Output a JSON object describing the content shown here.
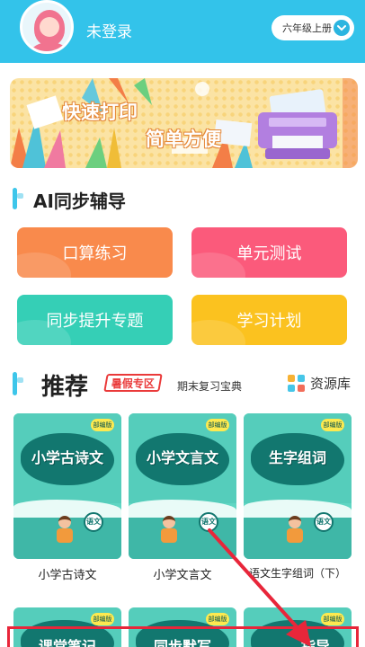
{
  "header": {
    "login_status": "未登录",
    "grade_selector": "六年级上册"
  },
  "banner": {
    "title_line1": "快速打印",
    "title_line2": "简单方便"
  },
  "ai_section": {
    "title": "AI同步辅导",
    "buttons": [
      {
        "label": "口算练习",
        "color": "#f98a4c"
      },
      {
        "label": "单元测试",
        "color": "#fb5a7b"
      },
      {
        "label": "同步提升专题",
        "color": "#35cfb6"
      },
      {
        "label": "学习计划",
        "color": "#fbc21f"
      }
    ]
  },
  "recommend": {
    "title": "推荐",
    "hot_tag": "暑假专区",
    "review_tag": "期末复习宝典",
    "resource_link": "资源库",
    "books": [
      {
        "cover_title": "小学古诗文",
        "badge": "部编版",
        "subject": "语文",
        "label": "小学古诗文"
      },
      {
        "cover_title": "小学文言文",
        "badge": "部编版",
        "subject": "语文",
        "label": "小学文言文"
      },
      {
        "cover_title": "生字组词",
        "badge": "部编版",
        "subject": "语文",
        "label": "语文生字组词（下）"
      }
    ],
    "more_books": [
      {
        "cover_title": "课堂笔记",
        "badge": "部编版"
      },
      {
        "cover_title": "同步默写",
        "badge": "部编版"
      },
      {
        "cover_title": "指导",
        "badge": "部编版"
      }
    ]
  },
  "annotation": {
    "highlight_color": "#e8263a"
  }
}
